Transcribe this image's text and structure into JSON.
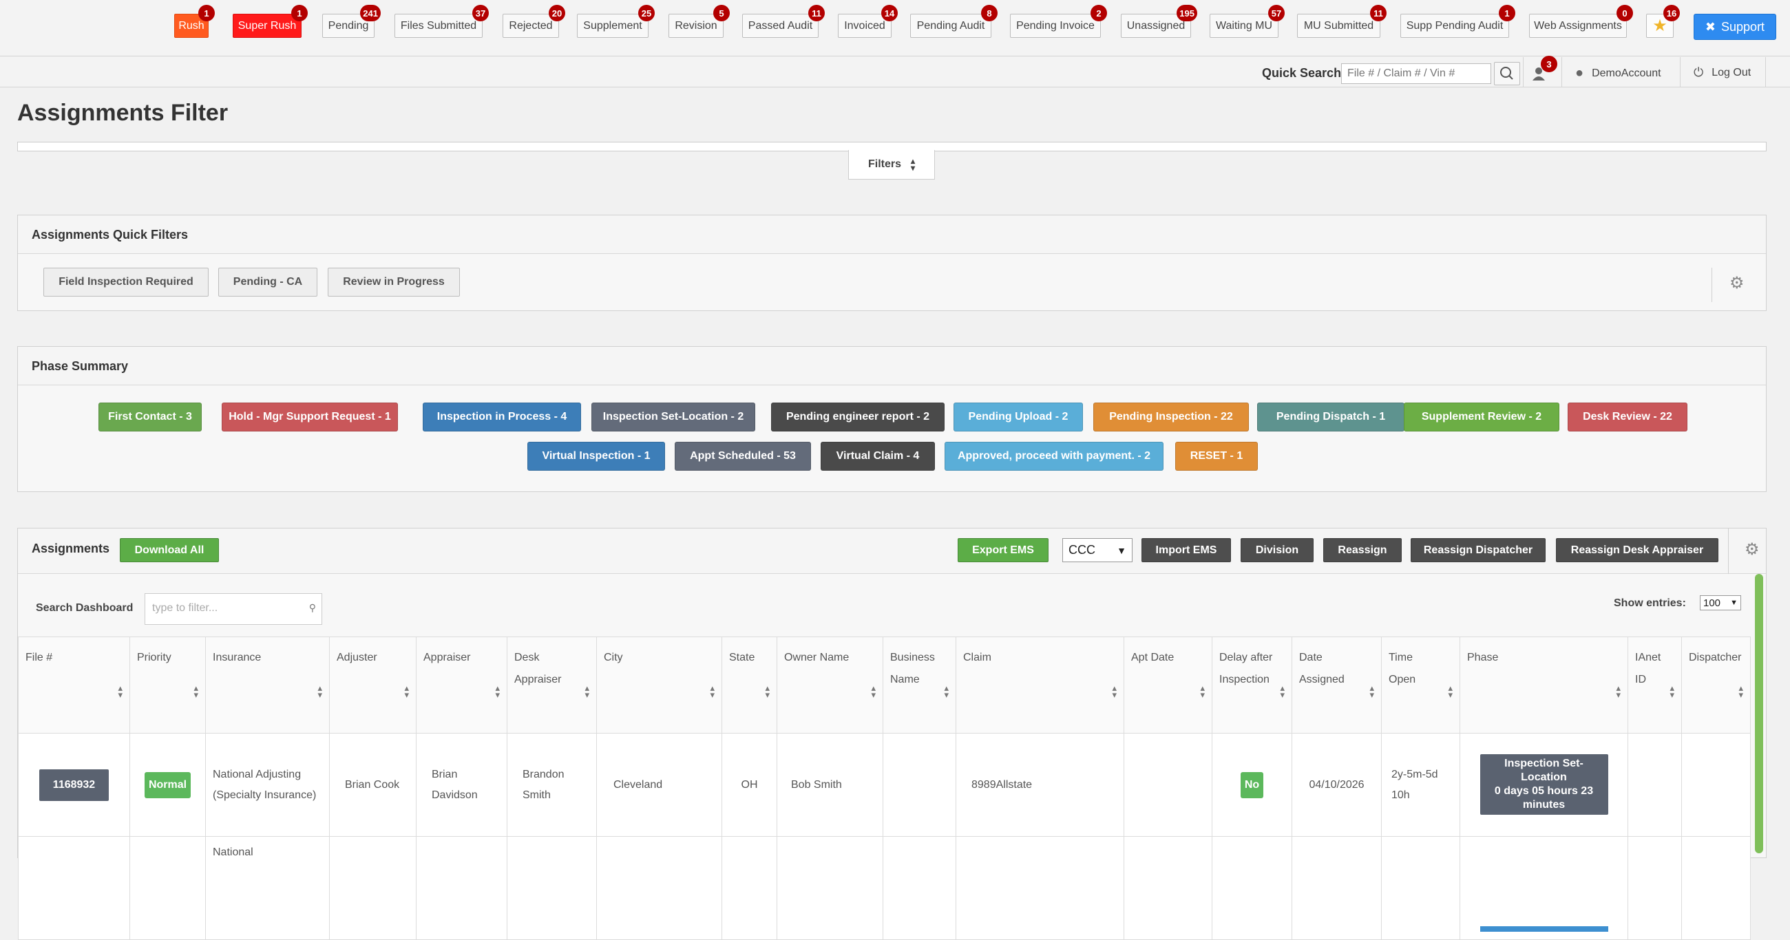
{
  "topbar": {
    "statuses": [
      {
        "label": "Rush",
        "count": "1"
      },
      {
        "label": "Super Rush",
        "count": "1"
      },
      {
        "label": "Pending",
        "count": "241"
      },
      {
        "label": "Files Submitted",
        "count": "37"
      },
      {
        "label": "Rejected",
        "count": "20"
      },
      {
        "label": "Supplement",
        "count": "25"
      },
      {
        "label": "Revision",
        "count": "5"
      },
      {
        "label": "Passed Audit",
        "count": "11"
      },
      {
        "label": "Invoiced",
        "count": "14"
      },
      {
        "label": "Pending Audit",
        "count": "8"
      },
      {
        "label": "Pending Invoice",
        "count": "2"
      },
      {
        "label": "Unassigned",
        "count": "195"
      },
      {
        "label": "Waiting MU",
        "count": "57"
      },
      {
        "label": "MU Submitted",
        "count": "11"
      },
      {
        "label": "Supp Pending Audit",
        "count": "1"
      },
      {
        "label": "Web Assignments",
        "count": "0"
      }
    ],
    "favorites_count": "16",
    "support_label": "Support"
  },
  "userbar": {
    "quick_search_label": "Quick Search",
    "quick_search_placeholder": "File # / Claim # / Vin #",
    "notifications_count": "3",
    "account_name": "DemoAccount",
    "logout_label": "Log Out"
  },
  "page": {
    "title": "Assignments Filter",
    "filters_label": "Filters"
  },
  "quick_filters": {
    "title": "Assignments Quick Filters",
    "buttons": [
      "Field Inspection Required",
      "Pending - CA",
      "Review in Progress"
    ]
  },
  "phase_summary": {
    "title": "Phase Summary",
    "phases": [
      {
        "label": "First Contact - 3",
        "color": "#6aa84f"
      },
      {
        "label": "Hold - Mgr Support Request - 1",
        "color": "#c9575a"
      },
      {
        "label": "Inspection in Process - 4",
        "color": "#3d7eb8"
      },
      {
        "label": "Inspection Set-Location - 2",
        "color": "#636b7a"
      },
      {
        "label": "Pending engineer report - 2",
        "color": "#4a4a4a"
      },
      {
        "label": "Pending Upload - 2",
        "color": "#5aaed8"
      },
      {
        "label": "Pending Inspection - 22",
        "color": "#e08e36"
      },
      {
        "label": "Pending Dispatch - 1",
        "color": "#5e938f"
      },
      {
        "label": "Supplement Review  - 2",
        "color": "#6cae45"
      },
      {
        "label": "Desk Review - 22",
        "color": "#c9575a"
      },
      {
        "label": "Virtual Inspection - 1",
        "color": "#3d7eb8"
      },
      {
        "label": "Appt Scheduled - 53",
        "color": "#636b7a"
      },
      {
        "label": "Virtual Claim - 4",
        "color": "#4a4a4a"
      },
      {
        "label": "Approved, proceed with payment. - 2",
        "color": "#5aaed8"
      },
      {
        "label": "RESET - 1",
        "color": "#e08e36"
      }
    ]
  },
  "assignments": {
    "title": "Assignments",
    "download_all": "Download All",
    "export_ems": "Export EMS",
    "ems_format": "CCC",
    "import_ems": "Import EMS",
    "division": "Division",
    "reassign": "Reassign",
    "reassign_dispatcher": "Reassign Dispatcher",
    "reassign_desk_appraiser": "Reassign Desk Appraiser",
    "search_label": "Search Dashboard",
    "search_placeholder": "type to filter...",
    "show_entries_label": "Show entries:",
    "show_entries_value": "100",
    "columns": [
      "File #",
      "Priority",
      "Insurance",
      "Adjuster",
      "Appraiser",
      "Desk Appraiser",
      "City",
      "State",
      "Owner Name",
      "Business Name",
      "Claim",
      "Apt Date",
      "Delay after Inspection",
      "Date Assigned",
      "Time Open",
      "Phase",
      "IAnet ID",
      "Dispatcher"
    ],
    "rows": [
      {
        "file": "1168932",
        "priority": "Normal",
        "insurance": "National Adjusting (Specialty Insurance)",
        "adjuster": "Brian Cook",
        "appraiser": "Brian Davidson",
        "desk_appraiser": "Brandon Smith",
        "city": "Cleveland",
        "state": "OH",
        "owner": "Bob Smith",
        "business": "",
        "claim": "8989Allstate",
        "apt_date": "",
        "delay": "No",
        "date_assigned": "04/10/2026",
        "time_open": "2y-5m-5d 10h",
        "phase": "Inspection Set-Location",
        "phase_detail": "0 days 05 hours 23 minutes",
        "ianet": "",
        "dispatcher": ""
      },
      {
        "insurance": "National"
      }
    ]
  }
}
